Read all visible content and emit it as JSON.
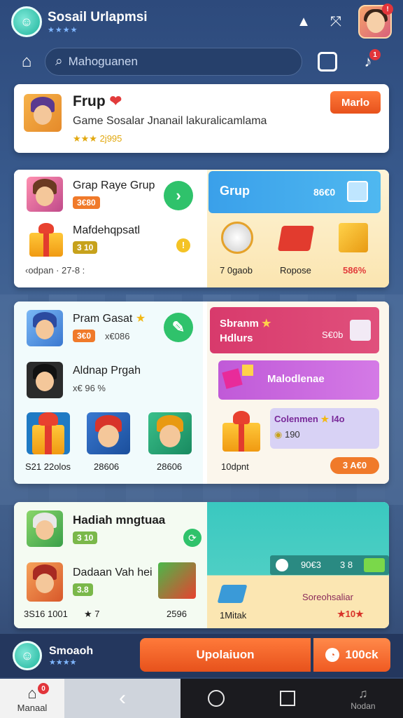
{
  "app": {
    "title": "Sosail Urlapmsi",
    "stars": "★★★★"
  },
  "search": {
    "placeholder": "Mahoguanen",
    "value": ""
  },
  "header_card": {
    "title": "Frup",
    "subtitle": "Game Sosalar Jnanail lakuralicamlama",
    "meta": "★★★ 2j995",
    "button": "Marlo"
  },
  "group_card": {
    "item1_title": "Grap Raye Grup",
    "item1_pill": "3€80",
    "item2_title": "Mafdehqpsatl",
    "item2_pill": "3 10",
    "footer": "‹odpan · 27-8 :",
    "banner_title": "Grup",
    "banner_value": "86€0",
    "rewards": [
      "7 0gaob",
      "Ropose",
      "586%"
    ]
  },
  "mid_card": {
    "item1_title": "Pram Gasat",
    "item1_pill": "3€0",
    "item1_meta": "x€086",
    "item2_title": "Aldnap Prgah",
    "item2_meta": "x€ 96 %",
    "grid_labels": [
      "S21 22olos",
      "28606",
      "28606"
    ],
    "banner_title": "Sbranm",
    "banner_sub": "Hdlurs",
    "banner_value": "S€0b",
    "promo_label": "Malodlenae",
    "coupon_title": "Colenmen",
    "coupon_suffix": "I4o",
    "coupon_value": "190",
    "gift_label": "10dpnt",
    "gift_price": "3 A€0"
  },
  "bottom_card": {
    "item1_title": "Hadiah mngtuaa",
    "item1_pill": "3 10",
    "item2_title": "Dadaan Vah hei",
    "item2_pill": "3.8",
    "footer_left": "3S16 1001",
    "footer_mid": "7",
    "footer_right": "2596",
    "counter_a": "90€3",
    "counter_b": "3 8",
    "right_label": "Soreohsaliar",
    "right_value": "10",
    "left_label": "1Mitak"
  },
  "bottom_bar": {
    "name": "Smoaoh",
    "stars": "★★★★",
    "primary": "Upolaiuon",
    "secondary": "100ck"
  },
  "navbar": {
    "home_label": "Manaal",
    "right_label": "Nodan"
  },
  "colors": {
    "accent": "#e7521c",
    "green": "#2fc26b",
    "blue": "#3aa0ea",
    "pink": "#d83a6c",
    "purple": "#c05ad8"
  }
}
